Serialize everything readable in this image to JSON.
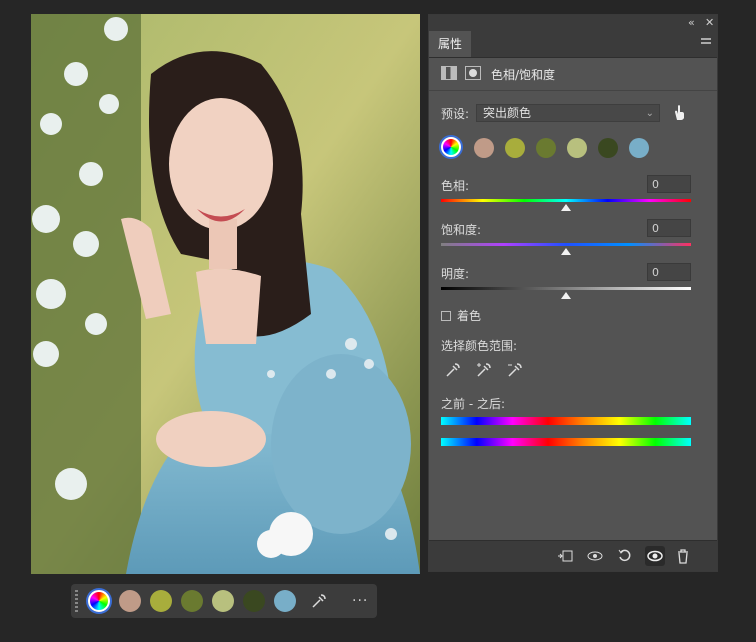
{
  "panel": {
    "tab_label": "属性",
    "adjustment_title": "色相/饱和度",
    "preset_label": "预设:",
    "preset_value": "突出颜色",
    "hue_label": "色相:",
    "hue_value": "0",
    "hue_level": 0.5,
    "saturation_label": "饱和度:",
    "saturation_value": "0",
    "saturation_level": 0.5,
    "lightness_label": "明度:",
    "lightness_value": "0",
    "lightness_level": 0.5,
    "colorize_label": "着色",
    "colorize_checked": false,
    "select_range_label": "选择颜色范围:",
    "before_after_label": "之前 - 之后:"
  },
  "swatches": [
    "#c09b88",
    "#a8ad3c",
    "#6a7a30",
    "#b8c07e",
    "#3a4820",
    "#78aec8"
  ],
  "icons": {
    "top_bar": [
      "collapse-icon",
      "close-icon"
    ],
    "header": [
      "adjustment-layer-icon",
      "mask-icon"
    ],
    "preset": "hand-target-icon",
    "droppers": [
      "eyedropper-icon",
      "eyedropper-plus-icon",
      "eyedropper-minus-icon"
    ],
    "bottom_bar": [
      "clip-to-layer-icon",
      "view-previous-icon",
      "reset-icon",
      "visibility-icon",
      "delete-icon"
    ],
    "dock": [
      "color-wheel-icon",
      "eyedropper-icon",
      "more-icon"
    ]
  },
  "dock_more": "···",
  "collapse_glyph": "«",
  "close_glyph": "✕"
}
